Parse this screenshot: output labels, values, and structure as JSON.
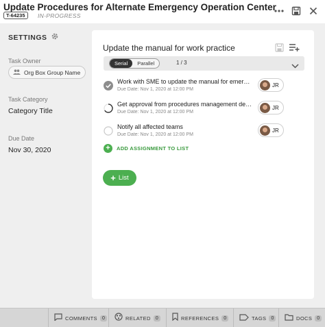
{
  "header": {
    "title": "Update Procedures for Alternate Emergency Operation Center",
    "task_id": "T-64235",
    "status": "IN-PROGRESS"
  },
  "sidebar": {
    "settings_label": "SETTINGS",
    "owner_label": "Task Owner",
    "owner_value": "Org Box Group Name",
    "category_label": "Task Category",
    "category_value": "Category Title",
    "due_label": "Due Date",
    "due_value": "Nov 30, 2020"
  },
  "panel": {
    "title": "Update the manual for work practice",
    "mode_serial": "Serial",
    "mode_parallel": "Parallel",
    "pager": "1 / 3",
    "tasks": [
      {
        "name": "Work with SME to update the manual for emergency procedures",
        "due": "Due Date: Nov 1, 2020 at 12:00 PM",
        "assignee": "JR",
        "state": "complete"
      },
      {
        "name": "Get approval from procedures management department",
        "due": "Due Date: Nov 1, 2020 at 12:00 PM",
        "assignee": "JR",
        "state": "in-progress"
      },
      {
        "name": "Notify all affected teams",
        "due": "Due Date: Nov 1, 2020 at 12:00 PM",
        "assignee": "JR",
        "state": "not-started"
      }
    ],
    "add_assignment_label": "ADD ASSIGNMENT TO LIST",
    "list_button_label": "List"
  },
  "footer": {
    "tabs": [
      {
        "label": "COMMENTS",
        "count": "0"
      },
      {
        "label": "RELATED",
        "count": "0"
      },
      {
        "label": "REFERENCES",
        "count": "0"
      },
      {
        "label": "TAGS",
        "count": "0"
      },
      {
        "label": "DOCS",
        "count": "0"
      }
    ]
  },
  "colors": {
    "accent_green": "#4caf50",
    "toggle_active": "#333333"
  }
}
